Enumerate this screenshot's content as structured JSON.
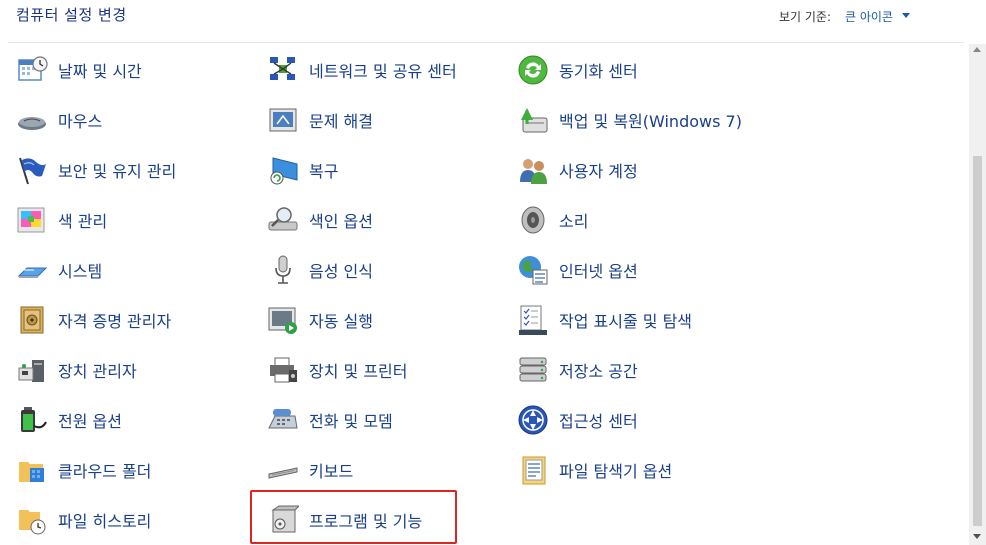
{
  "header": {
    "title": "컴퓨터 설정 변경",
    "view_by_label": "보기 기준:",
    "view_by_value": "큰 아이콘"
  },
  "columns": [
    [
      {
        "label": "날짜 및 시간",
        "icon": "calendar-clock-icon"
      },
      {
        "label": "마우스",
        "icon": "mouse-icon"
      },
      {
        "label": "보안 및 유지 관리",
        "icon": "flag-icon"
      },
      {
        "label": "색 관리",
        "icon": "color-management-icon"
      },
      {
        "label": "시스템",
        "icon": "computer-icon"
      },
      {
        "label": "자격 증명 관리자",
        "icon": "vault-icon"
      },
      {
        "label": "장치 관리자",
        "icon": "device-manager-icon"
      },
      {
        "label": "전원 옵션",
        "icon": "battery-icon"
      },
      {
        "label": "클라우드 폴더",
        "icon": "cloud-folder-icon"
      },
      {
        "label": "파일 히스토리",
        "icon": "file-history-icon"
      }
    ],
    [
      {
        "label": "네트워크 및 공유 센터",
        "icon": "network-icon"
      },
      {
        "label": "문제 해결",
        "icon": "troubleshooting-icon"
      },
      {
        "label": "복구",
        "icon": "recovery-icon"
      },
      {
        "label": "색인 옵션",
        "icon": "indexing-icon"
      },
      {
        "label": "음성 인식",
        "icon": "microphone-icon"
      },
      {
        "label": "자동 실행",
        "icon": "autoplay-icon"
      },
      {
        "label": "장치 및 프린터",
        "icon": "printer-icon"
      },
      {
        "label": "전화 및 모뎀",
        "icon": "phone-modem-icon"
      },
      {
        "label": "키보드",
        "icon": "keyboard-icon"
      },
      {
        "label": "프로그램 및 기능",
        "icon": "programs-icon"
      }
    ],
    [
      {
        "label": "동기화 센터",
        "icon": "sync-icon"
      },
      {
        "label": "백업 및 복원(Windows 7)",
        "icon": "backup-icon"
      },
      {
        "label": "사용자 계정",
        "icon": "user-accounts-icon"
      },
      {
        "label": "소리",
        "icon": "speaker-icon"
      },
      {
        "label": "인터넷 옵션",
        "icon": "internet-options-icon"
      },
      {
        "label": "작업 표시줄 및 탐색",
        "icon": "taskbar-icon"
      },
      {
        "label": "저장소 공간",
        "icon": "storage-spaces-icon"
      },
      {
        "label": "접근성 센터",
        "icon": "ease-of-access-icon"
      },
      {
        "label": "파일 탐색기 옵션",
        "icon": "folder-options-icon"
      }
    ]
  ],
  "colors": {
    "link": "#1a3f8c",
    "title": "#1e3287",
    "highlight": "#e02424"
  }
}
